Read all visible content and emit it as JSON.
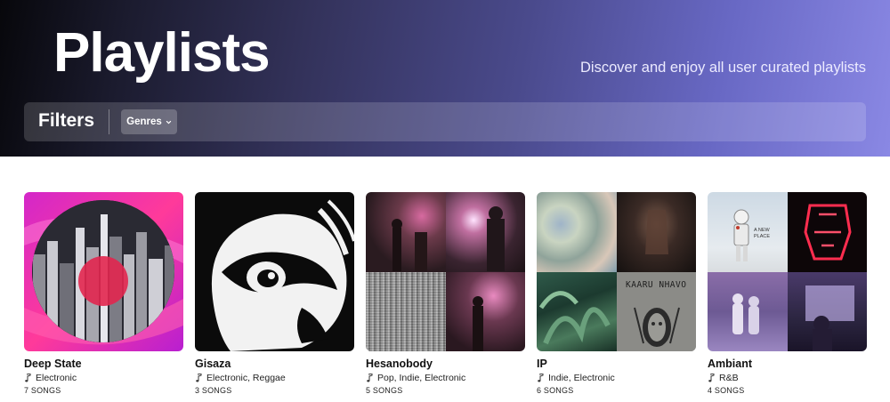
{
  "header": {
    "title": "Playlists",
    "subtitle": "Discover and enjoy all user curated playlists"
  },
  "filters": {
    "label": "Filters",
    "genres_label": "Genres"
  },
  "colors": {
    "hero_start": "#07070b",
    "hero_end": "#8a88e4",
    "text": "#111111"
  },
  "playlists": [
    {
      "title": "Deep State",
      "genres": "Electronic",
      "count": "7 SONGS"
    },
    {
      "title": "Gisaza",
      "genres": "Electronic, Reggae",
      "count": "3 SONGS"
    },
    {
      "title": "Hesanobody",
      "genres": "Pop, Indie, Electronic",
      "count": "5 SONGS"
    },
    {
      "title": "IP",
      "genres": "Indie, Electronic",
      "count": "6 SONGS"
    },
    {
      "title": "Ambiant",
      "genres": "R&B",
      "count": "4 SONGS"
    }
  ],
  "cover_text": {
    "ip_album": "KAARU NHAVO",
    "ambiant_album": "A NEW PLACE"
  }
}
